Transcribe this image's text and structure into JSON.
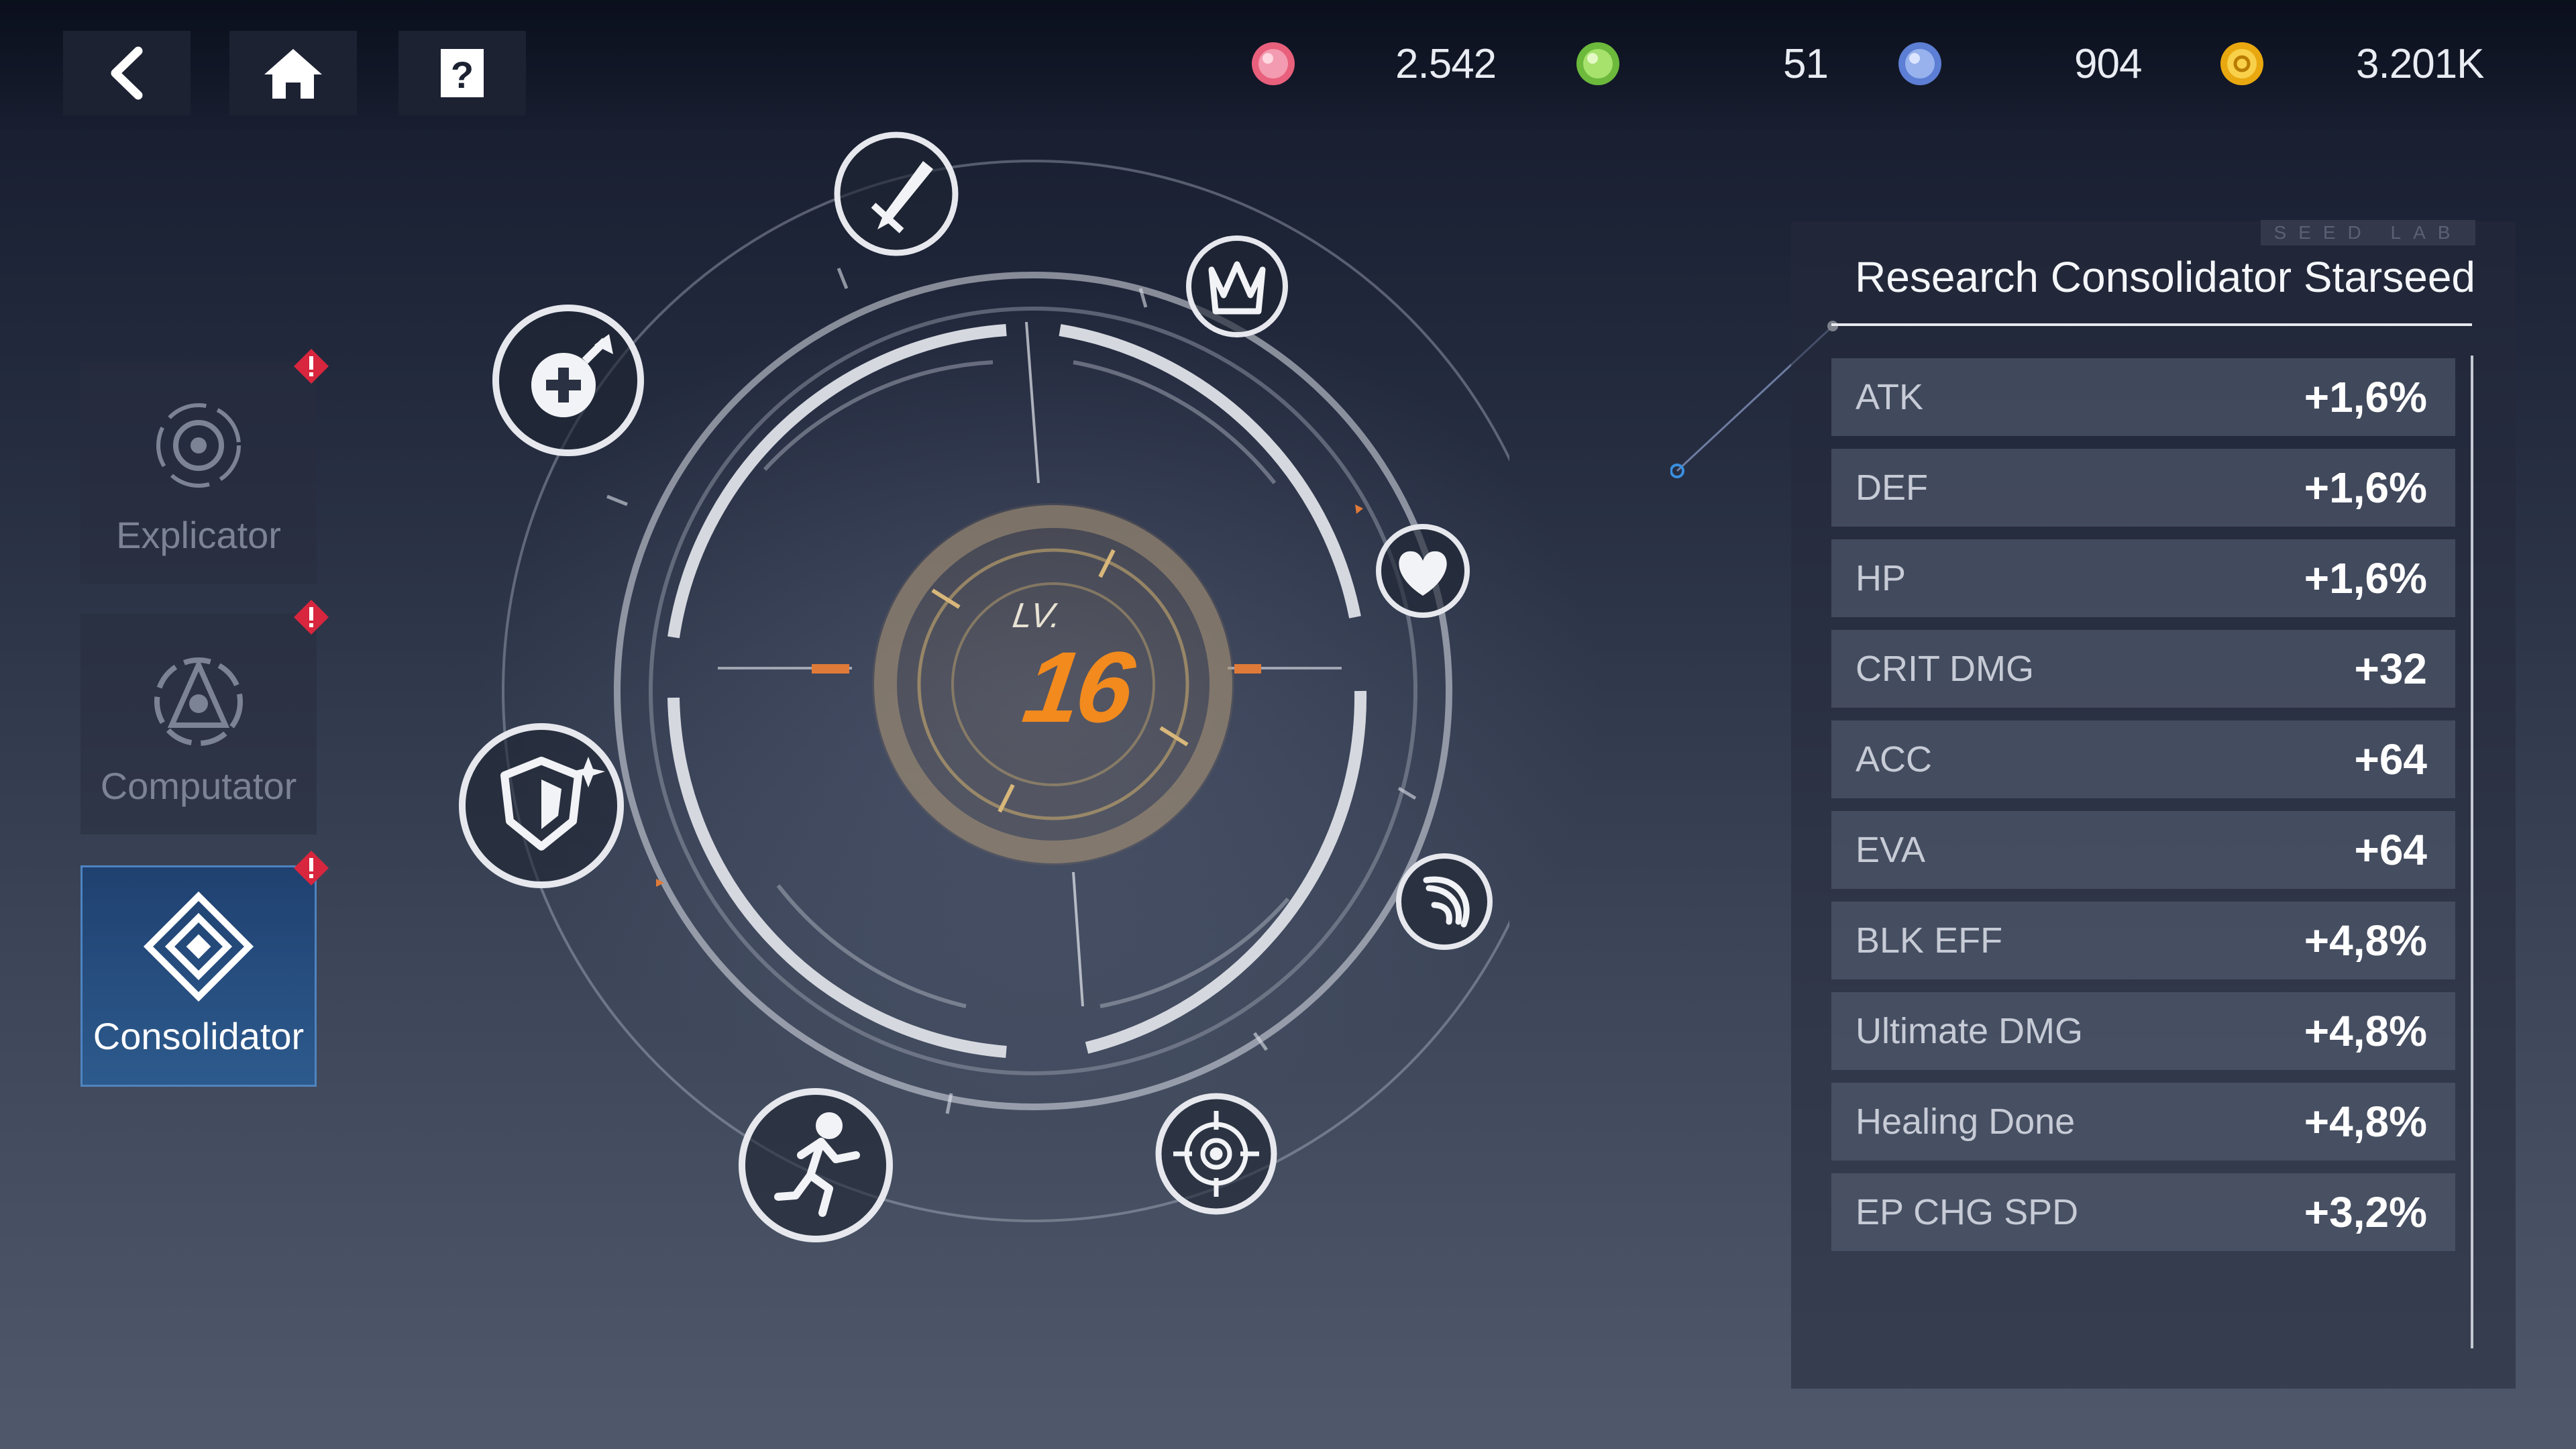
{
  "nav": {
    "back_icon": "chevron-left-icon",
    "home_icon": "home-icon",
    "help_icon": "help-icon"
  },
  "resources": [
    {
      "icon": "pink-crystal-icon",
      "color": "#e8607c",
      "value": "2.542"
    },
    {
      "icon": "green-crystal-icon",
      "color": "#7fce4a",
      "value": "51"
    },
    {
      "icon": "blue-crystal-icon",
      "color": "#6d8fe0",
      "value": "904"
    },
    {
      "icon": "gold-coin-icon",
      "color": "#f2b81c",
      "value": "3.201K"
    }
  ],
  "sidebar": {
    "items": [
      {
        "label": "Explicator",
        "icon": "explicator-icon",
        "alert": true,
        "active": false
      },
      {
        "label": "Computator",
        "icon": "computator-icon",
        "alert": true,
        "active": false
      },
      {
        "label": "Consolidator",
        "icon": "consolidator-icon",
        "alert": true,
        "active": true
      }
    ]
  },
  "core": {
    "level_prefix": "LV.",
    "level_value": "16",
    "accent": "#f28a1e"
  },
  "nodes": [
    {
      "name": "sword-node",
      "icon": "sword-icon"
    },
    {
      "name": "crown-node",
      "icon": "crown-icon"
    },
    {
      "name": "heart-node",
      "icon": "heart-icon"
    },
    {
      "name": "wave-node",
      "icon": "wave-icon"
    },
    {
      "name": "target-node",
      "icon": "crosshair-icon"
    },
    {
      "name": "runner-node",
      "icon": "runner-icon"
    },
    {
      "name": "shield-node",
      "icon": "shield-icon"
    },
    {
      "name": "heal-node",
      "icon": "heal-icon"
    }
  ],
  "panel": {
    "tag": "SEED LAB",
    "title": "Research Consolidator Starseed",
    "stats": [
      {
        "name": "ATK",
        "value": "+1,6%"
      },
      {
        "name": "DEF",
        "value": "+1,6%"
      },
      {
        "name": "HP",
        "value": "+1,6%"
      },
      {
        "name": "CRIT DMG",
        "value": "+32"
      },
      {
        "name": "ACC",
        "value": "+64"
      },
      {
        "name": "EVA",
        "value": "+64"
      },
      {
        "name": "BLK EFF",
        "value": "+4,8%"
      },
      {
        "name": "Ultimate DMG",
        "value": "+4,8%"
      },
      {
        "name": "Healing Done",
        "value": "+4,8%"
      },
      {
        "name": "EP CHG SPD",
        "value": "+3,2%"
      }
    ]
  },
  "colors": {
    "alert": "#d7263d",
    "active_tab": "#2d5a8d"
  }
}
